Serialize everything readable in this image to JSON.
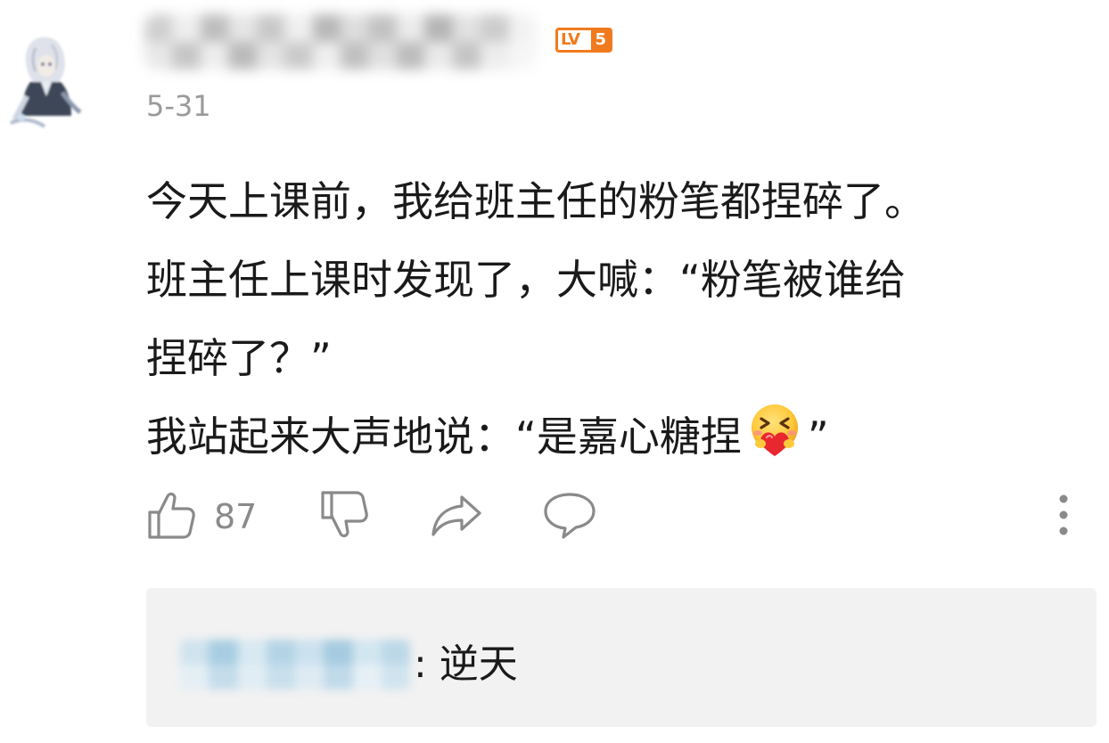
{
  "post": {
    "date": "5-31",
    "level": {
      "prefix": "LV",
      "number": "5"
    },
    "body_lines": [
      "今天上课前，我给班主任的粉笔都捏碎了。",
      "班主任上课时发现了，大喊：“粉笔被谁给",
      "捏碎了？”"
    ],
    "last_line_text": "我站起来大声地说：“是嘉心糖捏",
    "last_line_tail": "”",
    "emoji": "hugging-heart-emoji"
  },
  "actions": {
    "like_count": "87",
    "icons": [
      "thumbs-up-icon",
      "thumbs-down-icon",
      "share-icon",
      "comment-icon",
      "more-icon"
    ]
  },
  "replies": [
    {
      "text": ": 逆天"
    }
  ],
  "colors": {
    "accent": "#f07b1e",
    "date_gray": "#9a9a9a",
    "icon_gray": "#8a8a8a",
    "reply_bg": "#f2f2f2",
    "text": "#1a1a1a"
  }
}
